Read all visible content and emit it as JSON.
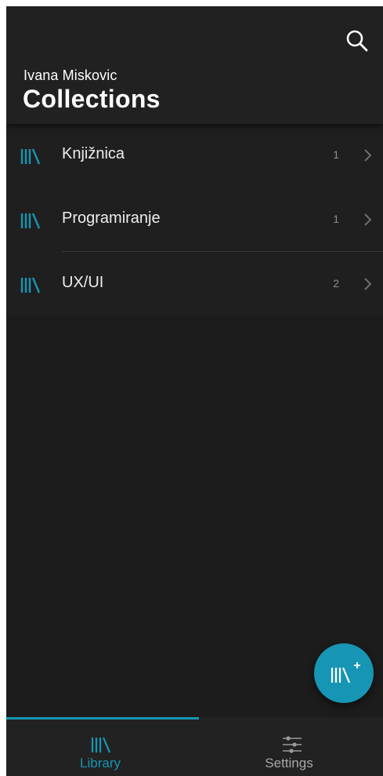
{
  "header": {
    "user_name": "Ivana Miskovic",
    "title": "Collections",
    "search_icon": "search-icon"
  },
  "collections": [
    {
      "name": "Knjižnica",
      "count": "1",
      "icon": "library-icon"
    },
    {
      "name": "Programiranje",
      "count": "1",
      "icon": "library-icon"
    },
    {
      "name": "UX/UI",
      "count": "2",
      "icon": "library-icon"
    }
  ],
  "fab": {
    "icon": "add-library-icon"
  },
  "nav": {
    "items": [
      {
        "label": "Library",
        "icon": "library-icon",
        "active": true
      },
      {
        "label": "Settings",
        "icon": "sliders-icon",
        "active": false
      }
    ]
  },
  "colors": {
    "accent": "#1696b4",
    "background": "#1c1c1c",
    "appbar": "#212121",
    "text_primary": "#ffffff",
    "text_muted": "#8c8c8c"
  }
}
